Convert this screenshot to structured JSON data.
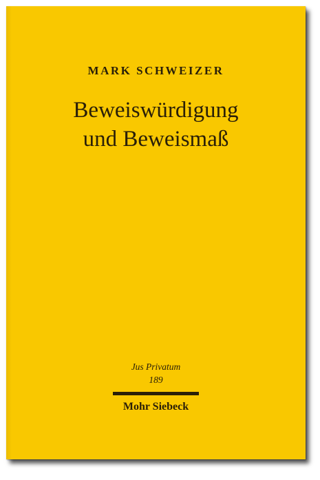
{
  "cover": {
    "author": "MARK SCHWEIZER",
    "title_line_1": "Beweiswürdigung",
    "title_line_2": "und Beweismaß",
    "series_name": "Jus Privatum",
    "series_number": "189",
    "publisher": "Mohr Siebeck",
    "background_color": "#f9c800",
    "text_color": "#2a1f08"
  }
}
